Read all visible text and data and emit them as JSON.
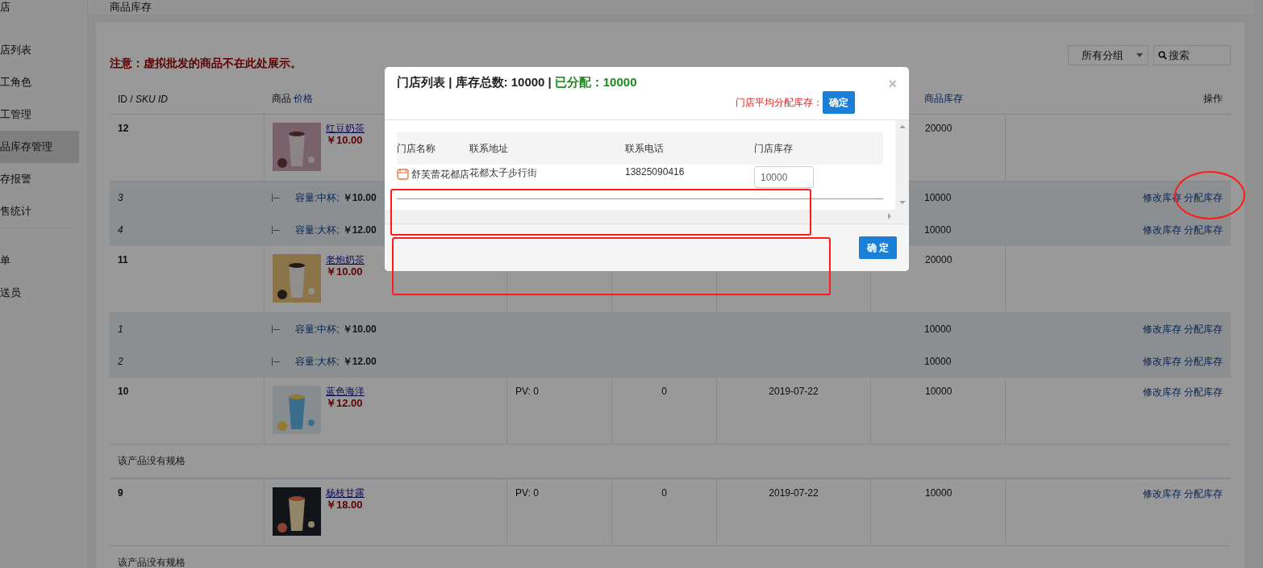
{
  "sidebar": {
    "items": [
      {
        "label": "店",
        "selected": false
      },
      {
        "label": "店列表",
        "selected": false
      },
      {
        "label": "工角色",
        "selected": false
      },
      {
        "label": "工管理",
        "selected": false
      },
      {
        "label": "品库存管理",
        "selected": true
      },
      {
        "label": "存报警",
        "selected": false
      },
      {
        "label": "售统计",
        "selected": false
      },
      {
        "label": "单",
        "selected": false
      },
      {
        "label": "送员",
        "selected": false
      }
    ]
  },
  "header_title": "商品库存",
  "notice": "注意：虚拟批发的商品不在此处展示。",
  "filters": {
    "group": "所有分组",
    "search_placeholder": "搜索"
  },
  "table": {
    "headers": {
      "id": "ID / *SKU ID*",
      "product": "商品",
      "price": "价格",
      "stock": "商品库存",
      "actions": "操作"
    },
    "rows": [
      {
        "kind": "product",
        "id": "12",
        "name": "红豆奶茶",
        "price": "￥10.00",
        "stock": "20000"
      },
      {
        "kind": "sku",
        "id": "3",
        "spec": "容量:中杯;",
        "price": "￥10.00",
        "stock": "10000",
        "actions": [
          "修改库存",
          "分配库存"
        ]
      },
      {
        "kind": "sku",
        "id": "4",
        "spec": "容量:大杯;",
        "price": "￥12.00",
        "stock": "10000",
        "actions": [
          "修改库存",
          "分配库存"
        ]
      },
      {
        "kind": "product",
        "id": "11",
        "name": "老炮奶茶",
        "price": "￥10.00",
        "stock": "20000"
      },
      {
        "kind": "sku",
        "id": "1",
        "spec": "容量:中杯;",
        "price": "￥10.00",
        "stock": "10000",
        "actions": [
          "修改库存",
          "分配库存"
        ]
      },
      {
        "kind": "sku",
        "id": "2",
        "spec": "容量:大杯;",
        "price": "￥12.00",
        "stock": "10000",
        "actions": [
          "修改库存",
          "分配库存"
        ]
      },
      {
        "kind": "product",
        "id": "10",
        "name": "蓝色海洋",
        "price": "￥12.00",
        "column_3": "PV: 0",
        "column_4": "0",
        "column_5": "2019-07-22",
        "stock": "10000",
        "actions": [
          "修改库存",
          "分配库存"
        ]
      },
      {
        "kind": "note",
        "text": "该产品没有规格"
      },
      {
        "kind": "product",
        "id": "9",
        "name": "杨枝甘露",
        "price": "￥18.00",
        "column_3": "PV: 0",
        "column_4": "0",
        "column_5": "2019-07-22",
        "stock": "10000",
        "actions": [
          "修改库存",
          "分配库存"
        ]
      },
      {
        "kind": "note",
        "text": "该产品没有规格"
      }
    ]
  },
  "modal": {
    "title": "门店列表 | 库存总数: 10000 |",
    "allocated": "已分配：10000",
    "close": "×",
    "average_label": "门店平均分配库存：",
    "average_button": "确定",
    "columns": [
      "门店名称",
      "联系地址",
      "联系电话",
      "门店库存"
    ],
    "stores": [
      {
        "name": "舒芙蕾花都店",
        "address": "花都太子步行街",
        "phone": "13825090416",
        "stock": "10000"
      }
    ],
    "confirm": "确 定"
  },
  "annotations": [
    {
      "kind": "rectangle"
    },
    {
      "kind": "rectangle"
    },
    {
      "kind": "ellipse"
    }
  ]
}
